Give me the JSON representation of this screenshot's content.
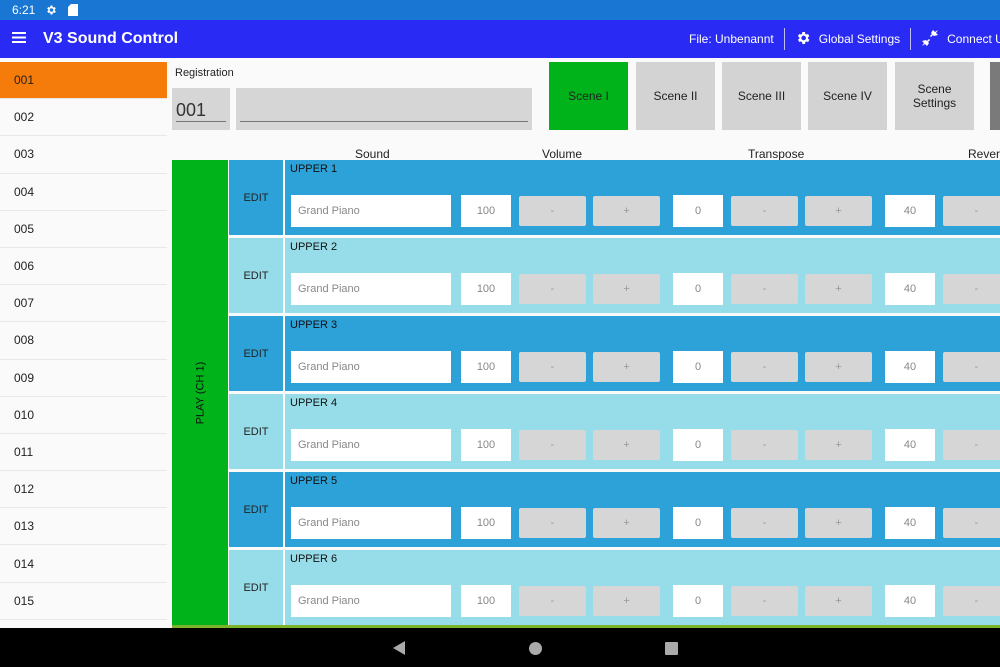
{
  "status_bar": {
    "time": "6:21",
    "icons": [
      "gear-icon",
      "sd-card-icon"
    ]
  },
  "app_bar": {
    "title": "V3 Sound Control",
    "file_label": "File: Unbenannt",
    "global_settings_label": "Global Settings",
    "connect_label": "Connect US"
  },
  "registrations": {
    "selected": "001",
    "items": [
      "001",
      "002",
      "003",
      "004",
      "005",
      "006",
      "007",
      "008",
      "009",
      "010",
      "011",
      "012",
      "013",
      "014",
      "015"
    ]
  },
  "registration_editor": {
    "label": "Registration",
    "number": "001",
    "name": ""
  },
  "scenes": [
    {
      "label": "Scene I",
      "active": true
    },
    {
      "label": "Scene II",
      "active": false
    },
    {
      "label": "Scene III",
      "active": false
    },
    {
      "label": "Scene IV",
      "active": false
    },
    {
      "label": "Scene Settings",
      "active": false
    }
  ],
  "columns": {
    "sound": "Sound",
    "volume": "Volume",
    "transpose": "Transpose",
    "reverb": "Reverb"
  },
  "play_label": "PLAY (CH 1)",
  "edit_label": "EDIT",
  "minus_label": "-",
  "plus_label": "+",
  "parts": [
    {
      "name": "UPPER 1",
      "sound": "Grand Piano",
      "volume": "100",
      "transpose": "0",
      "reverb": "40"
    },
    {
      "name": "UPPER 2",
      "sound": "Grand Piano",
      "volume": "100",
      "transpose": "0",
      "reverb": "40"
    },
    {
      "name": "UPPER 3",
      "sound": "Grand Piano",
      "volume": "100",
      "transpose": "0",
      "reverb": "40"
    },
    {
      "name": "UPPER 4",
      "sound": "Grand Piano",
      "volume": "100",
      "transpose": "0",
      "reverb": "40"
    },
    {
      "name": "UPPER 5",
      "sound": "Grand Piano",
      "volume": "100",
      "transpose": "0",
      "reverb": "40"
    },
    {
      "name": "UPPER 6",
      "sound": "Grand Piano",
      "volume": "100",
      "transpose": "0",
      "reverb": "40"
    }
  ],
  "colors": {
    "app_bar": "#2a2af5",
    "status_bar": "#1976d2",
    "selected_registration": "#f57c0a",
    "active_scene": "#00b31a",
    "row_dark": "#2da2d8",
    "row_light": "#97dde9"
  }
}
